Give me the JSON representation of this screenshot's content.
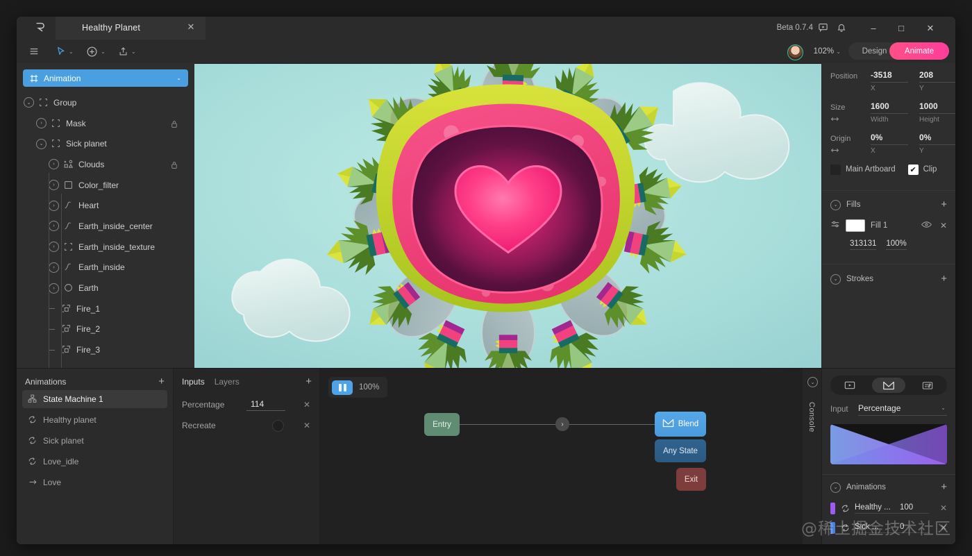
{
  "window": {
    "logo_icon": "rive-logo",
    "tab_title": "Healthy Planet",
    "close_tab_icon": "close-icon",
    "beta_label": "Beta 0.7.4",
    "feedback_icon": "feedback-icon",
    "bell_icon": "notification-bell-icon",
    "minimize": "–",
    "maximize": "□",
    "close": "✕"
  },
  "toolbar": {
    "menu_icon": "hamburger-menu-icon",
    "select_icon": "select-cursor-icon",
    "add_icon": "add-circle-icon",
    "export_icon": "export-share-icon",
    "caret": "⌄",
    "zoom_level": "102%",
    "design_label": "Design",
    "animate_label": "Animate"
  },
  "artboard": {
    "icon": "artboard-icon",
    "label": "Animation",
    "caret": "⌄"
  },
  "tree": [
    {
      "label": "Group",
      "icon": "group-icon",
      "depth": 0,
      "expanded": true,
      "locked": false,
      "disc": "⌄"
    },
    {
      "label": "Mask",
      "icon": "group-icon",
      "depth": 1,
      "expanded": false,
      "locked": true,
      "disc": "›"
    },
    {
      "label": "Sick planet",
      "icon": "group-icon",
      "depth": 1,
      "expanded": true,
      "locked": false,
      "disc": "⌄"
    },
    {
      "label": "Clouds",
      "icon": "shapes-icon",
      "depth": 2,
      "expanded": false,
      "locked": true,
      "disc": "›"
    },
    {
      "label": "Color_filter",
      "icon": "rect-icon",
      "depth": 2,
      "expanded": false,
      "locked": false,
      "disc": "›"
    },
    {
      "label": "Heart",
      "icon": "path-icon",
      "depth": 2,
      "expanded": false,
      "locked": false,
      "disc": "›"
    },
    {
      "label": "Earth_inside_center",
      "icon": "path-icon",
      "depth": 2,
      "expanded": false,
      "locked": false,
      "disc": "›"
    },
    {
      "label": "Earth_inside_texture",
      "icon": "group-icon",
      "depth": 2,
      "expanded": false,
      "locked": false,
      "disc": "›"
    },
    {
      "label": "Earth_inside",
      "icon": "path-icon",
      "depth": 2,
      "expanded": false,
      "locked": false,
      "disc": "›"
    },
    {
      "label": "Earth",
      "icon": "ellipse-icon",
      "depth": 2,
      "expanded": false,
      "locked": false,
      "disc": "›"
    },
    {
      "label": "Fire_1",
      "icon": "nested-artboard-icon",
      "depth": 2,
      "expanded": null,
      "locked": false,
      "disc": ""
    },
    {
      "label": "Fire_2",
      "icon": "nested-artboard-icon",
      "depth": 2,
      "expanded": null,
      "locked": false,
      "disc": ""
    },
    {
      "label": "Fire_3",
      "icon": "nested-artboard-icon",
      "depth": 2,
      "expanded": null,
      "locked": false,
      "disc": ""
    }
  ],
  "inspector": {
    "position_label": "Position",
    "position_x": "-3518",
    "position_y": "208",
    "x_sub": "X",
    "y_sub": "Y",
    "size_label": "Size",
    "size_w": "1600",
    "size_h": "1000",
    "width_sub": "Width",
    "height_sub": "Height",
    "origin_label": "Origin",
    "origin_x": "0%",
    "origin_y": "0%",
    "main_artboard_label": "Main Artboard",
    "main_artboard_checked": false,
    "clip_label": "Clip",
    "clip_checked": true,
    "clip_check_glyph": "✔",
    "fills_label": "Fills",
    "fills_add": "+",
    "fill_name": "Fill 1",
    "fill_hex": "313131",
    "fill_opacity": "100%",
    "fill_options_icon": "sliders-icon",
    "fill_visible_icon": "eye-icon",
    "fill_remove_icon": "close-icon",
    "strokes_label": "Strokes",
    "strokes_add": "+",
    "collapse_caret": "⌄"
  },
  "animations_panel": {
    "title": "Animations",
    "add": "+",
    "items": [
      {
        "label": "State Machine 1",
        "icon": "state-machine-icon",
        "selected": true
      },
      {
        "label": "Healthy planet",
        "icon": "loop-icon",
        "selected": false
      },
      {
        "label": "Sick planet",
        "icon": "loop-icon",
        "selected": false
      },
      {
        "label": "Love_idle",
        "icon": "loop-icon",
        "selected": false
      },
      {
        "label": "Love",
        "icon": "oneshot-arrow-icon",
        "selected": false
      }
    ]
  },
  "inputs_panel": {
    "tab_inputs": "Inputs",
    "tab_layers": "Layers",
    "add": "+",
    "rows": [
      {
        "name": "Percentage",
        "type": "number",
        "value": "114",
        "remove": "✕"
      },
      {
        "name": "Recreate",
        "type": "boolean",
        "value": "",
        "remove": "✕"
      }
    ]
  },
  "graph": {
    "play_icon": "pause-icon",
    "play_percent": "100%",
    "nodes": [
      {
        "id": "entry",
        "label": "Entry",
        "kind": "entry"
      },
      {
        "id": "blend",
        "label": "Blend",
        "kind": "blend",
        "icon": "blend-icon"
      },
      {
        "id": "anystate",
        "label": "Any State",
        "kind": "any"
      },
      {
        "id": "exit",
        "label": "Exit",
        "kind": "exit"
      }
    ],
    "edge_arrow": "›",
    "console_label": "Console",
    "console_caret": "⌄"
  },
  "state_inspector": {
    "tabs": [
      {
        "icon": "play-rect-icon",
        "active": false
      },
      {
        "icon": "blend-icon",
        "active": true
      },
      {
        "icon": "settings-sliders-icon",
        "active": false
      }
    ],
    "input_label": "Input",
    "input_value": "Percentage",
    "input_caret": "⌄",
    "animations_label": "Animations",
    "animations_add": "+",
    "rows": [
      {
        "color": "#9b5cf0",
        "icon": "loop-icon",
        "name": "Healthy ...",
        "value": "100",
        "caret": "⌄",
        "remove": "✕"
      },
      {
        "color": "#4a7fe0",
        "icon": "loop-icon",
        "name": "Sick ...",
        "value": "0",
        "caret": "⌄",
        "remove": "✕"
      }
    ]
  },
  "watermark": "@稀土掘金技术社区",
  "colors": {
    "accent_blue": "#4a9fe0",
    "animate_pink": "#ff3d9a",
    "canvas_bg": "#a9dedb",
    "panel_bg": "#2e2e2e",
    "entry_green": "#5f8c72",
    "exit_red": "#7d3d3d"
  }
}
